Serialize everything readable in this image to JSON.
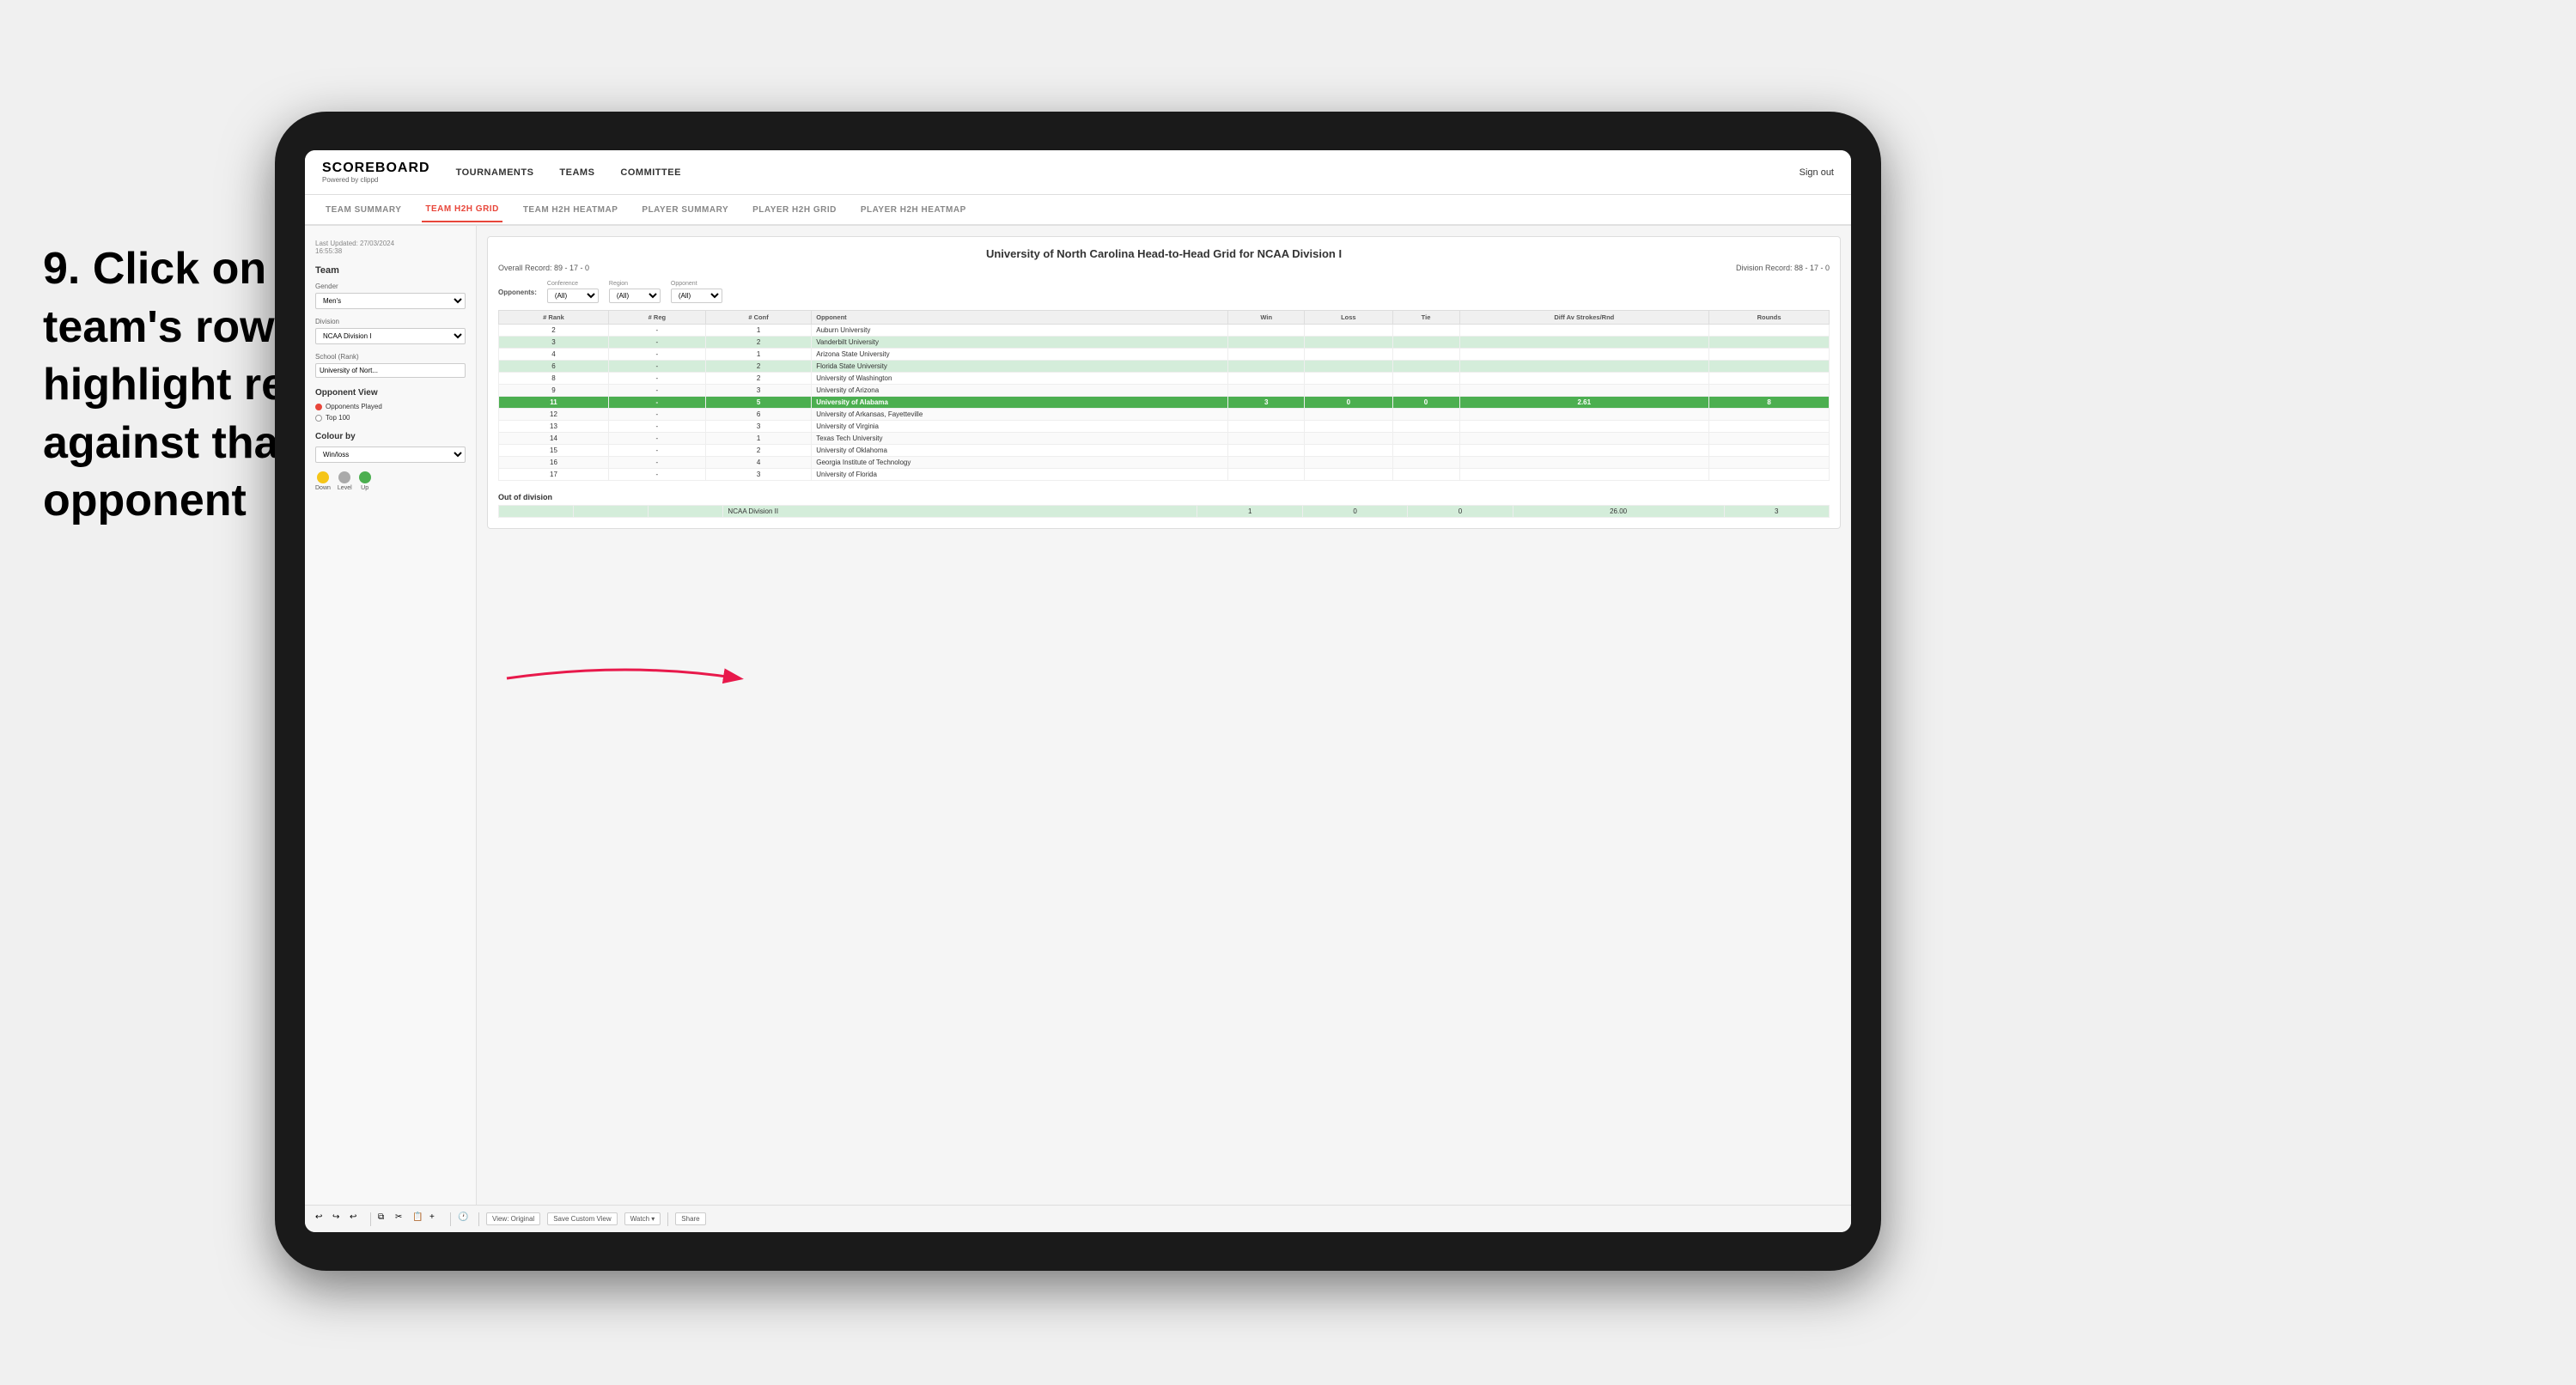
{
  "instruction": {
    "step": "9.",
    "text": "Click on a team's row to highlight results against that opponent"
  },
  "nav": {
    "logo": "SCOREBOARD",
    "logo_sub": "Powered by clippd",
    "items": [
      "TOURNAMENTS",
      "TEAMS",
      "COMMITTEE"
    ],
    "sign_out": "Sign out"
  },
  "sub_nav": {
    "items": [
      "TEAM SUMMARY",
      "TEAM H2H GRID",
      "TEAM H2H HEATMAP",
      "PLAYER SUMMARY",
      "PLAYER H2H GRID",
      "PLAYER H2H HEATMAP"
    ],
    "active": "TEAM H2H GRID"
  },
  "sidebar": {
    "last_updated": "Last Updated: 27/03/2024",
    "time": "16:55:38",
    "team_label": "Team",
    "gender_label": "Gender",
    "gender_value": "Men's",
    "division_label": "Division",
    "division_value": "NCAA Division I",
    "school_label": "School (Rank)",
    "school_value": "University of Nort...",
    "opponent_view_title": "Opponent View",
    "radio_options": [
      "Opponents Played",
      "Top 100"
    ],
    "radio_selected": 0,
    "colour_by_title": "Colour by",
    "colour_by_value": "Win/loss",
    "legend": [
      {
        "label": "Down",
        "color": "#f5c518"
      },
      {
        "label": "Level",
        "color": "#aaa"
      },
      {
        "label": "Up",
        "color": "#4caf50"
      }
    ]
  },
  "grid": {
    "title": "University of North Carolina Head-to-Head Grid for NCAA Division I",
    "overall_record": "Overall Record: 89 - 17 - 0",
    "division_record": "Division Record: 88 - 17 - 0",
    "filters": {
      "opponents_label": "Opponents:",
      "conference_label": "Conference",
      "conference_value": "(All)",
      "region_label": "Region",
      "region_value": "(All)",
      "opponent_label": "Opponent",
      "opponent_value": "(All)"
    },
    "columns": [
      "# Rank",
      "# Reg",
      "# Conf",
      "Opponent",
      "Win",
      "Loss",
      "Tie",
      "Diff Av Strokes/Rnd",
      "Rounds"
    ],
    "rows": [
      {
        "rank": "2",
        "reg": "-",
        "conf": "1",
        "opponent": "Auburn University",
        "win": "",
        "loss": "",
        "tie": "",
        "diff": "",
        "rounds": "",
        "style": "normal"
      },
      {
        "rank": "3",
        "reg": "-",
        "conf": "2",
        "opponent": "Vanderbilt University",
        "win": "",
        "loss": "",
        "tie": "",
        "diff": "",
        "rounds": "",
        "style": "light-green"
      },
      {
        "rank": "4",
        "reg": "-",
        "conf": "1",
        "opponent": "Arizona State University",
        "win": "",
        "loss": "",
        "tie": "",
        "diff": "",
        "rounds": "",
        "style": "normal"
      },
      {
        "rank": "6",
        "reg": "-",
        "conf": "2",
        "opponent": "Florida State University",
        "win": "",
        "loss": "",
        "tie": "",
        "diff": "",
        "rounds": "",
        "style": "light-green"
      },
      {
        "rank": "8",
        "reg": "-",
        "conf": "2",
        "opponent": "University of Washington",
        "win": "",
        "loss": "",
        "tie": "",
        "diff": "",
        "rounds": "",
        "style": "normal"
      },
      {
        "rank": "9",
        "reg": "-",
        "conf": "3",
        "opponent": "University of Arizona",
        "win": "",
        "loss": "",
        "tie": "",
        "diff": "",
        "rounds": "",
        "style": "normal"
      },
      {
        "rank": "11",
        "reg": "-",
        "conf": "5",
        "opponent": "University of Alabama",
        "win": "3",
        "loss": "0",
        "tie": "0",
        "diff": "2.61",
        "rounds": "8",
        "style": "highlighted"
      },
      {
        "rank": "12",
        "reg": "-",
        "conf": "6",
        "opponent": "University of Arkansas, Fayetteville",
        "win": "",
        "loss": "",
        "tie": "",
        "diff": "",
        "rounds": "",
        "style": "normal"
      },
      {
        "rank": "13",
        "reg": "-",
        "conf": "3",
        "opponent": "University of Virginia",
        "win": "",
        "loss": "",
        "tie": "",
        "diff": "",
        "rounds": "",
        "style": "normal"
      },
      {
        "rank": "14",
        "reg": "-",
        "conf": "1",
        "opponent": "Texas Tech University",
        "win": "",
        "loss": "",
        "tie": "",
        "diff": "",
        "rounds": "",
        "style": "normal"
      },
      {
        "rank": "15",
        "reg": "-",
        "conf": "2",
        "opponent": "University of Oklahoma",
        "win": "",
        "loss": "",
        "tie": "",
        "diff": "",
        "rounds": "",
        "style": "normal"
      },
      {
        "rank": "16",
        "reg": "-",
        "conf": "4",
        "opponent": "Georgia Institute of Technology",
        "win": "",
        "loss": "",
        "tie": "",
        "diff": "",
        "rounds": "",
        "style": "normal"
      },
      {
        "rank": "17",
        "reg": "-",
        "conf": "3",
        "opponent": "University of Florida",
        "win": "",
        "loss": "",
        "tie": "",
        "diff": "",
        "rounds": "",
        "style": "normal"
      }
    ],
    "out_of_division_label": "Out of division",
    "out_rows": [
      {
        "opponent": "NCAA Division II",
        "win": "1",
        "loss": "0",
        "tie": "0",
        "diff": "26.00",
        "rounds": "3",
        "style": "out"
      }
    ]
  },
  "toolbar": {
    "buttons": [
      "View: Original",
      "Save Custom View",
      "Watch ▾",
      "Share"
    ]
  }
}
